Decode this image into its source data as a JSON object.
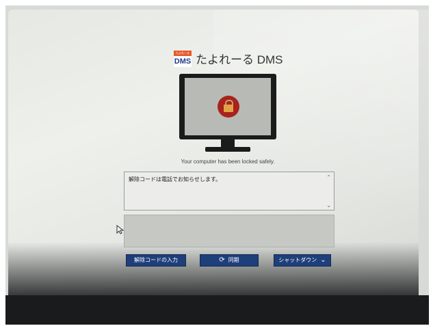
{
  "app": {
    "logo_top_text": "たよれーる",
    "logo_main_text": "DMS",
    "title": "たよれーる DMS"
  },
  "lock": {
    "message": "Your computer has been locked safely."
  },
  "notice": {
    "text": "解除コードは電話でお知らせします。"
  },
  "buttons": {
    "unlock_code": "解除コードの入力",
    "sync": "同期",
    "shutdown": "シャットダウン"
  },
  "icons": {
    "sync": "sync-icon",
    "chevron": "chevron-down-icon",
    "lock": "lock-icon",
    "cursor": "mouse-cursor-icon"
  },
  "colors": {
    "button": "#1e3f7a",
    "lock_circle": "#a8231c",
    "monitor": "#1b1b1b"
  }
}
